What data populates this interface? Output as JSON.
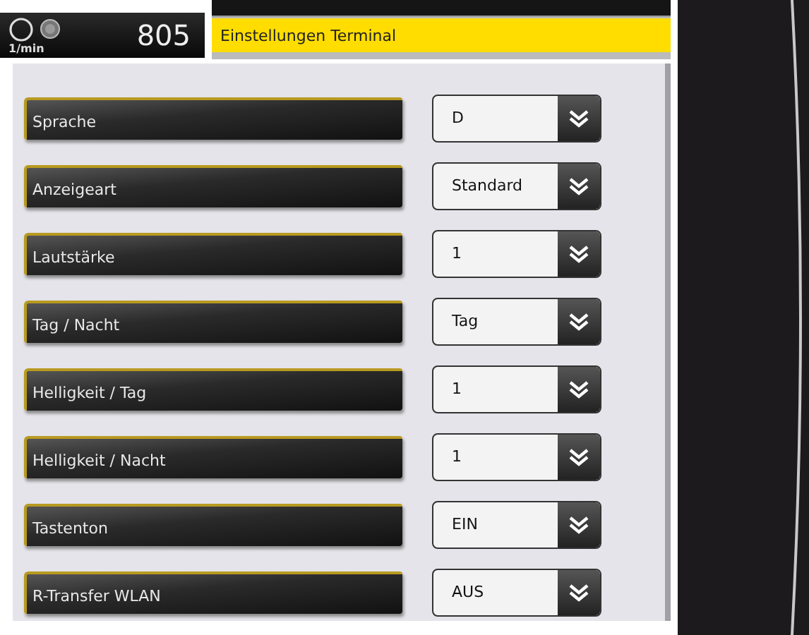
{
  "header": {
    "speed_unit": "1/min",
    "speed_value": "805",
    "title": "Einstellungen Terminal"
  },
  "settings": [
    {
      "label": "Sprache",
      "value": "D"
    },
    {
      "label": "Anzeigeart",
      "value": "Standard"
    },
    {
      "label": "Lautstärke",
      "value": "1"
    },
    {
      "label": "Tag / Nacht",
      "value": "Tag"
    },
    {
      "label": "Helligkeit / Tag",
      "value": "1"
    },
    {
      "label": "Helligkeit / Nacht",
      "value": "1"
    },
    {
      "label": "Tastenton",
      "value": "EIN"
    },
    {
      "label": "R-Transfer WLAN",
      "value": "AUS"
    }
  ]
}
